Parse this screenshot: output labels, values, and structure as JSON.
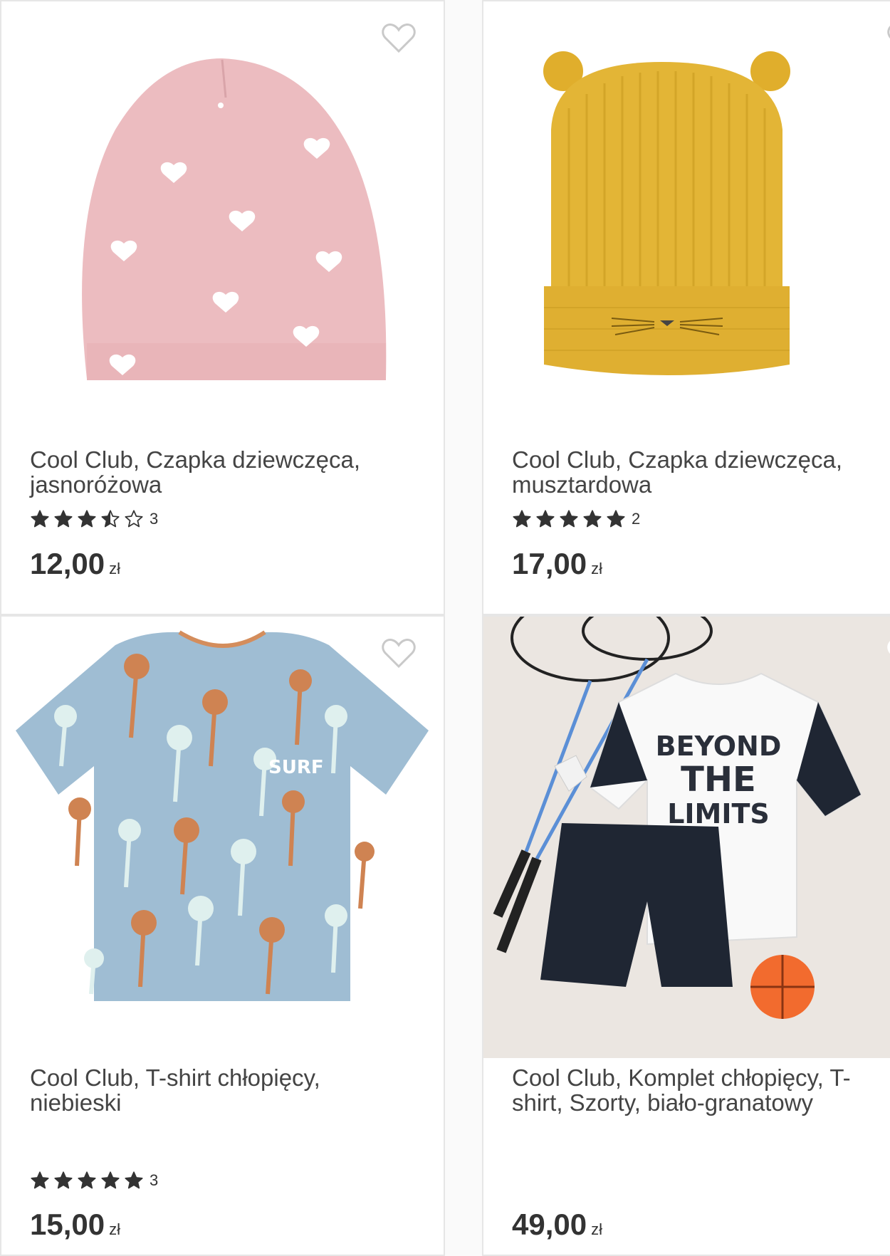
{
  "products": [
    {
      "title": "Cool Club, Czapka dziewczęca, jasnoróżowa",
      "rating": 3.5,
      "reviews": "3",
      "price": "12,00",
      "currency": "zł",
      "image": "pink-beanie-with-hearts"
    },
    {
      "title": "Cool Club, Czapka dziewczęca, musztardowa",
      "rating": 5,
      "reviews": "2",
      "price": "17,00",
      "currency": "zł",
      "image": "mustard-knit-hat-with-ears"
    },
    {
      "title": "Cool Club, T-shirt chłopięcy, niebieski",
      "rating": 5,
      "reviews": "3",
      "price": "15,00",
      "currency": "zł",
      "image": "blue-palm-tshirt",
      "print_text": "SURF"
    },
    {
      "title": "Cool Club, Komplet chłopięcy, T-shirt, Szorty, biało-granatowy",
      "price": "49,00",
      "currency": "zł",
      "image": "sport-set-with-rackets",
      "print_text": [
        "BEYOND",
        "THE",
        "LIMITS"
      ]
    }
  ],
  "colors": {
    "pink_hat": "#ecbcc0",
    "mustard_hat": "#e3b536",
    "blue_tshirt": "#9fbdd3",
    "palm_orange": "#cf8352",
    "navy": "#1f2633",
    "star": "#333333",
    "heart_outline": "#c9c9c9"
  }
}
